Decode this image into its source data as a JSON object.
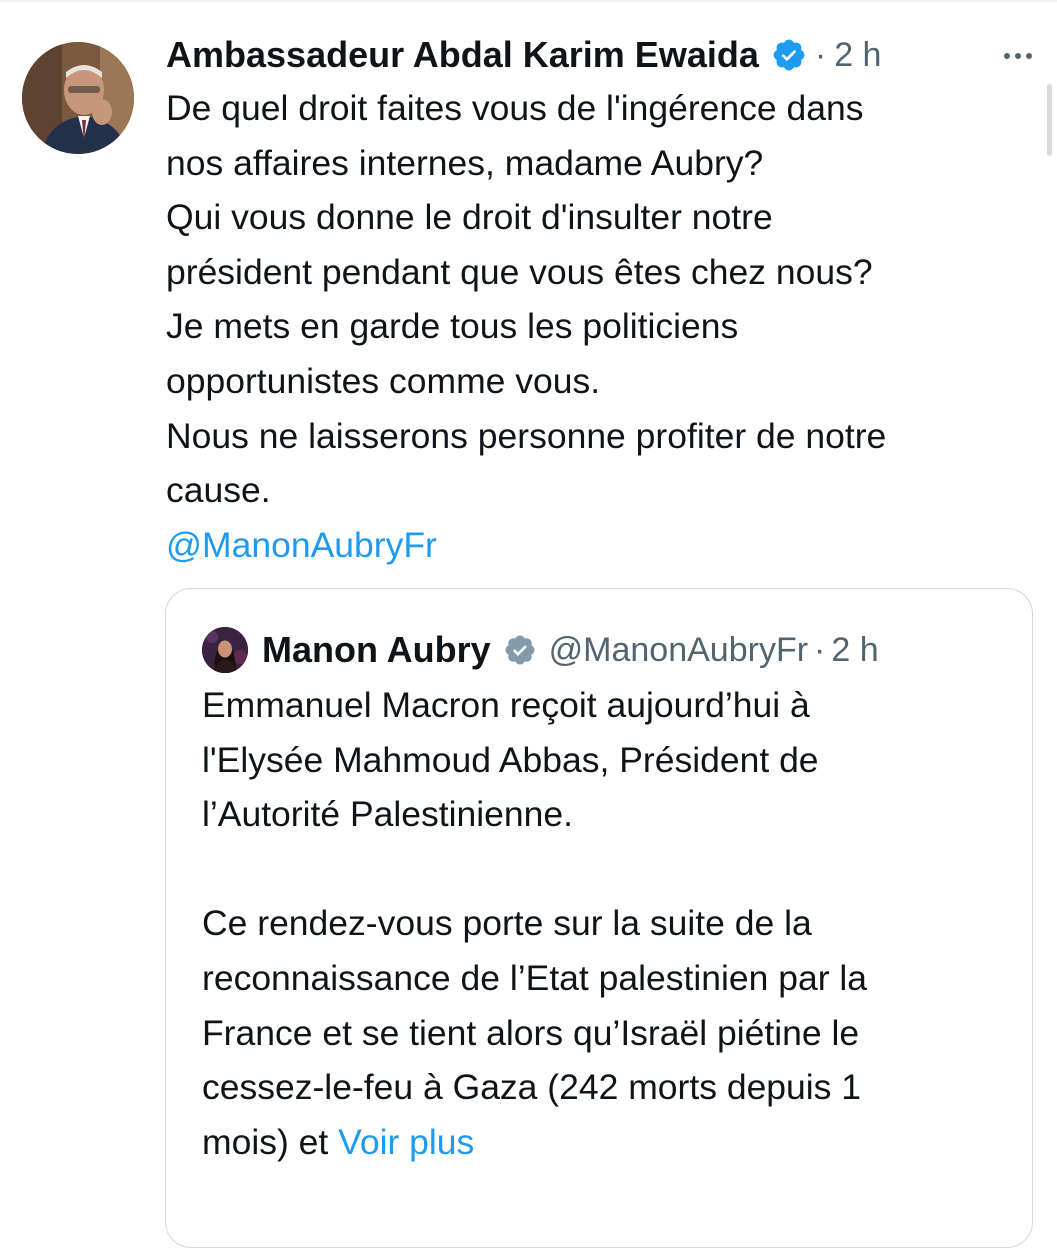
{
  "tweet": {
    "author_name": "Ambassadeur Abdal Karim Ewaida",
    "separator": "·",
    "time": "2 h",
    "body_lines": [
      "De quel droit faites vous de l'ingérence dans",
      "nos affaires internes, madame Aubry?",
      "Qui vous donne le droit d'insulter notre",
      "président pendant que vous êtes chez nous?",
      "Je mets en garde tous les politiciens",
      "opportunistes comme vous.",
      "Nous ne laisserons personne profiter de notre",
      "cause."
    ],
    "mention": "@ManonAubryFr",
    "icons": {
      "avatar": "author-avatar-photo",
      "verified": "verified-badge-icon",
      "more": "more-options-icon"
    },
    "colors": {
      "verified_blue": "#1d9bf0",
      "link_blue": "#1d9bf0",
      "secondary_text": "#536471",
      "border": "#cfd9de"
    }
  },
  "quoted_tweet": {
    "author_name": "Manon Aubry",
    "handle": "@ManonAubryFr",
    "separator": "·",
    "time": "2 h",
    "paragraph1_lines": [
      "Emmanuel Macron reçoit aujourd’hui à",
      "l'Elysée Mahmoud Abbas, Président de",
      "l’Autorité Palestinienne."
    ],
    "paragraph2_lines": [
      "Ce rendez-vous porte sur la suite de la",
      "reconnaissance de l’Etat palestinien par la",
      "France et se tient alors qu’Israël piétine le",
      "cessez-le-feu à Gaza (242 morts depuis 1"
    ],
    "last_line_text": "mois) et",
    "see_more": "Voir plus",
    "icons": {
      "avatar": "quoted-author-avatar-photo",
      "verified": "gray-verified-badge-icon"
    }
  }
}
